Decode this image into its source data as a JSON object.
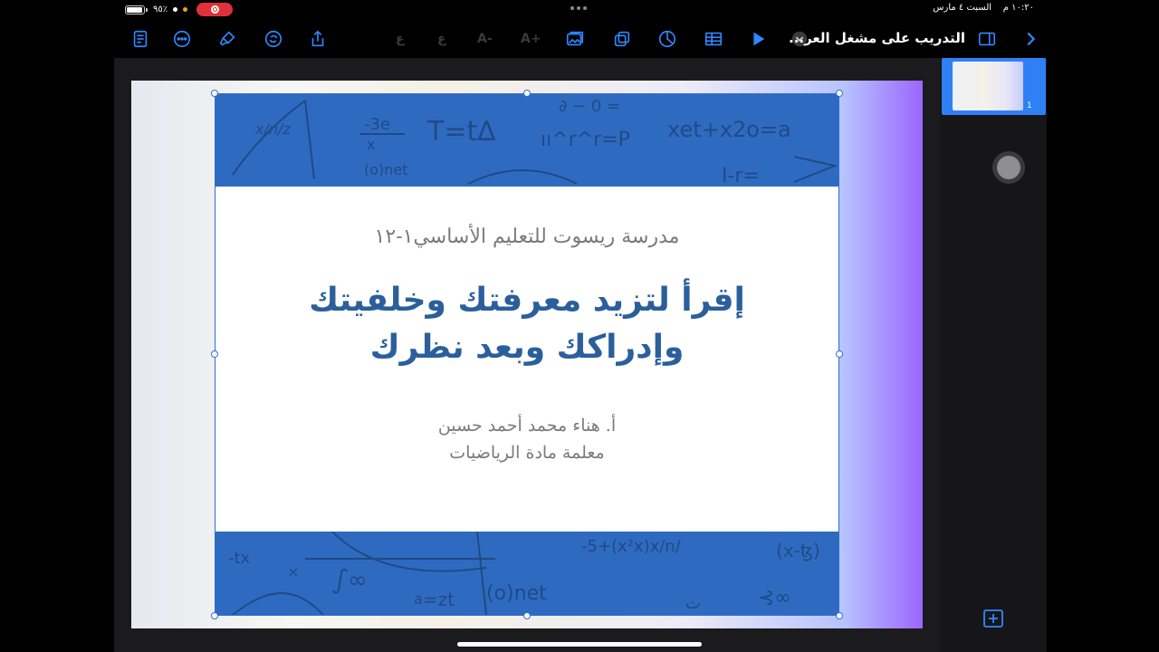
{
  "status": {
    "time": "١٠:٢٠ م",
    "date": "السبت ٤ مارس",
    "battery": "٩٥٪",
    "battery_level": 0.95
  },
  "toolbar": {
    "doc_title": "التدريب على مشغل العر...",
    "font_decrease_label": "A-",
    "font_increase_label": "A+",
    "para_label_1": "ع",
    "para_label_2": "ع",
    "accent_color": "#2f88ff"
  },
  "slide": {
    "school_name": "مدرسة ريسوت للتعليم الأساسي١-١٢",
    "headline_line1": "إقرأ لتزيد معرفتك وخلفيتك",
    "headline_line2": "وإدراكك وبعد نظرك",
    "teacher_name": "أ. هناء محمد أحمد حسين",
    "teacher_role": "معلمة مادة الرياضيات",
    "band_color": "#2e6bc0",
    "headline_color": "#2b5f9c"
  },
  "navigator": {
    "thumbnail_number": "1"
  }
}
